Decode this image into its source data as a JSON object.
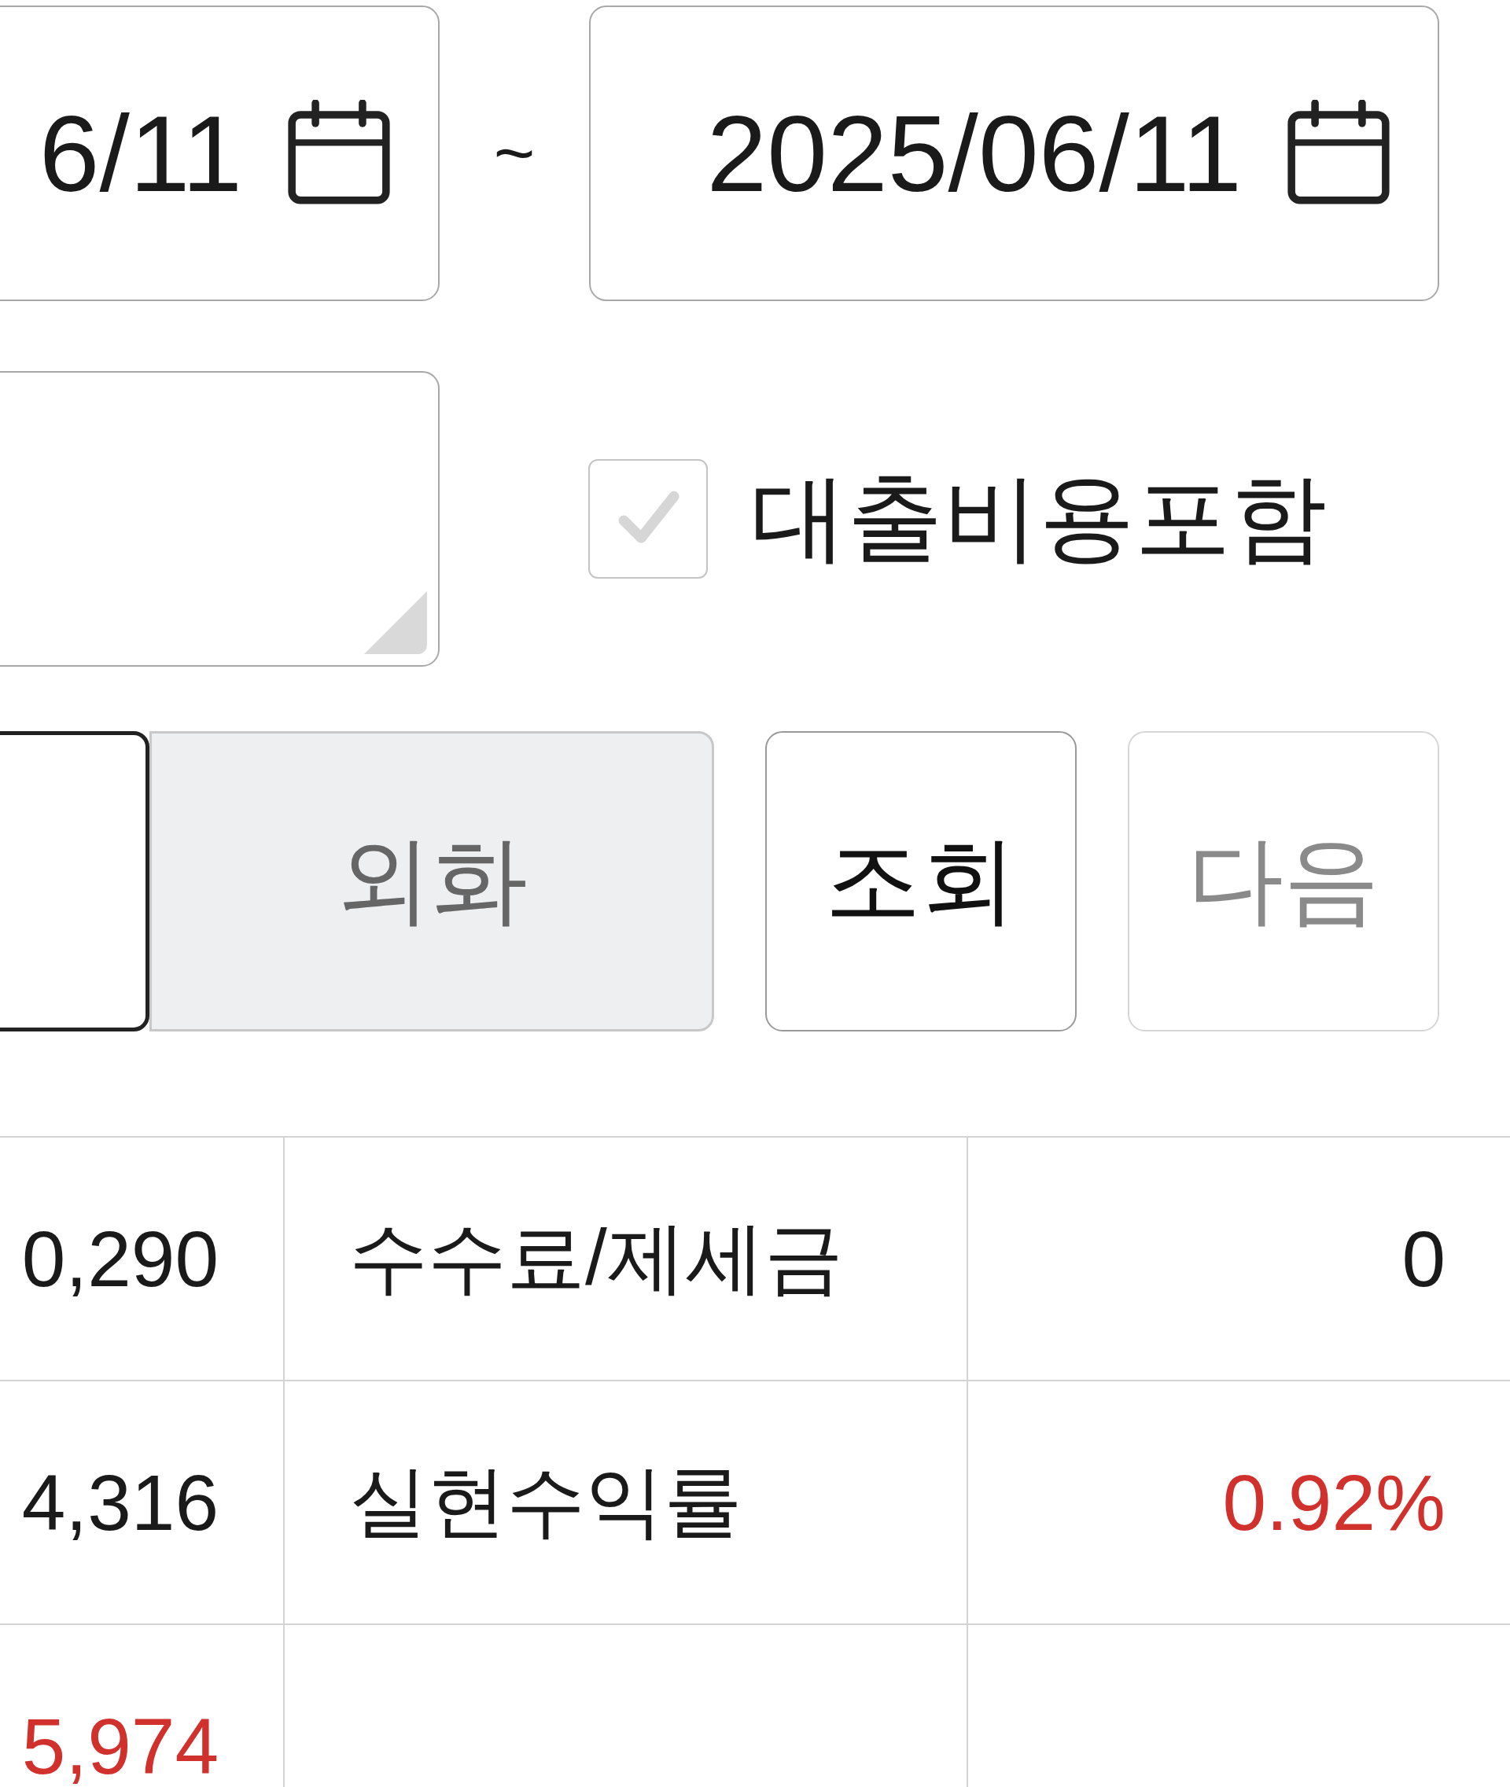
{
  "date_range": {
    "start": {
      "value": "6/11"
    },
    "separator": "~",
    "end": {
      "value": "2025/06/11"
    }
  },
  "include_loan_cost": {
    "label": "대출비용포함",
    "checked": true,
    "disabled": true
  },
  "currency_tabs": [
    {
      "selected": true
    },
    {
      "label": "외화",
      "selected": false
    }
  ],
  "buttons": [
    {
      "label": "조회",
      "disabled": false
    },
    {
      "label": "다음",
      "disabled": true
    }
  ],
  "summary_rows": [
    {
      "cells": [
        {
          "text": "0,290",
          "color": "#1a1a1a"
        },
        {
          "text": "수수료/제세금"
        },
        {
          "text": "0",
          "color": "#1a1a1a"
        }
      ]
    },
    {
      "cells": [
        {
          "text": "4,316",
          "color": "#1a1a1a"
        },
        {
          "text": "실현수익률"
        },
        {
          "text": "0.92%",
          "color": "#d0312d"
        }
      ]
    },
    {
      "cells": [
        {
          "text": "5,974",
          "color": "#d0312d"
        }
      ]
    }
  ]
}
